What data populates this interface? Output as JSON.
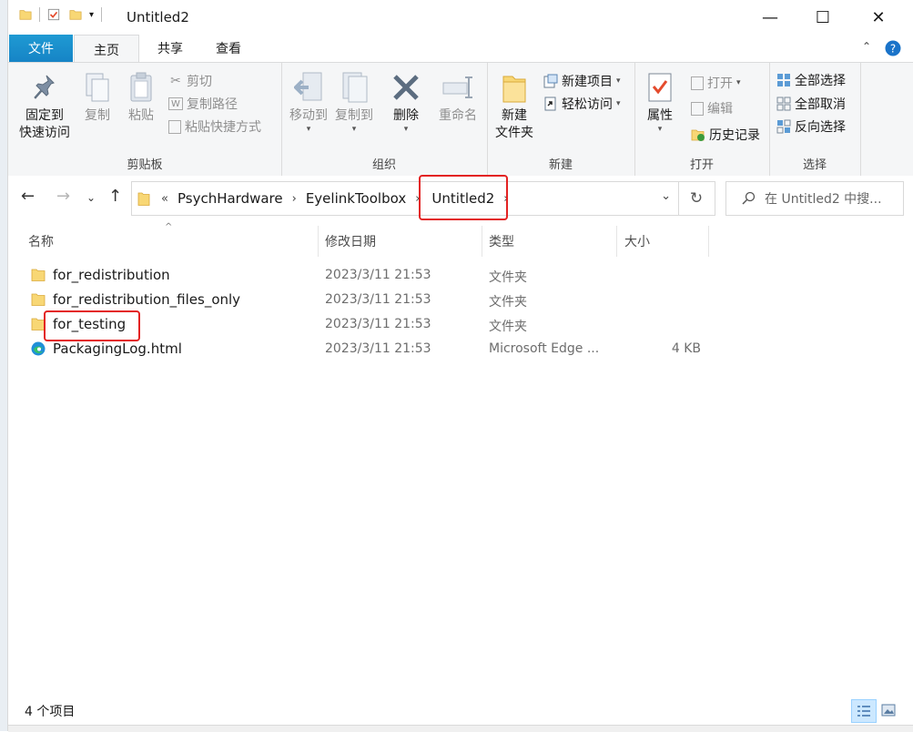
{
  "window": {
    "title": "Untitled2",
    "minimize": "—",
    "maximize": "☐",
    "close": "✕"
  },
  "ribbon_tabs": [
    "文件",
    "主页",
    "共享",
    "查看"
  ],
  "ribbon": {
    "clipboard": {
      "label": "剪贴板",
      "pin": "固定到\n快速访问",
      "copy": "复制",
      "paste": "粘贴",
      "cut": "剪切",
      "copy_path": "复制路径",
      "paste_shortcut": "粘贴快捷方式"
    },
    "organize": {
      "label": "组织",
      "move_to": "移动到",
      "copy_to": "复制到",
      "delete": "删除",
      "rename": "重命名"
    },
    "new": {
      "label": "新建",
      "new_folder": "新建\n文件夹",
      "new_item": "新建项目",
      "easy_access": "轻松访问"
    },
    "open": {
      "label": "打开",
      "properties": "属性",
      "open": "打开",
      "edit": "编辑",
      "history": "历史记录"
    },
    "select": {
      "label": "选择",
      "select_all": "全部选择",
      "select_none": "全部取消",
      "invert": "反向选择"
    }
  },
  "address": {
    "overflow": "«",
    "crumbs": [
      "PsychHardware",
      "EyelinkToolbox",
      "Untitled2"
    ],
    "search_placeholder": "在 Untitled2 中搜..."
  },
  "columns": {
    "name": "名称",
    "date": "修改日期",
    "type": "类型",
    "size": "大小"
  },
  "files": [
    {
      "name": "for_redistribution",
      "date": "2023/3/11 21:53",
      "type": "文件夹",
      "size": "",
      "icon": "folder-icon"
    },
    {
      "name": "for_redistribution_files_only",
      "date": "2023/3/11 21:53",
      "type": "文件夹",
      "size": "",
      "icon": "folder-icon"
    },
    {
      "name": "for_testing",
      "date": "2023/3/11 21:53",
      "type": "文件夹",
      "size": "",
      "icon": "folder-icon"
    },
    {
      "name": "PackagingLog.html",
      "date": "2023/3/11 21:53",
      "type": "Microsoft Edge ...",
      "size": "4 KB",
      "icon": "edge-icon"
    }
  ],
  "status": {
    "count": "4 个项目"
  },
  "colors": {
    "file_tab": "#1983c7",
    "highlight_box": "#e32222",
    "folder": "#f8d775"
  }
}
